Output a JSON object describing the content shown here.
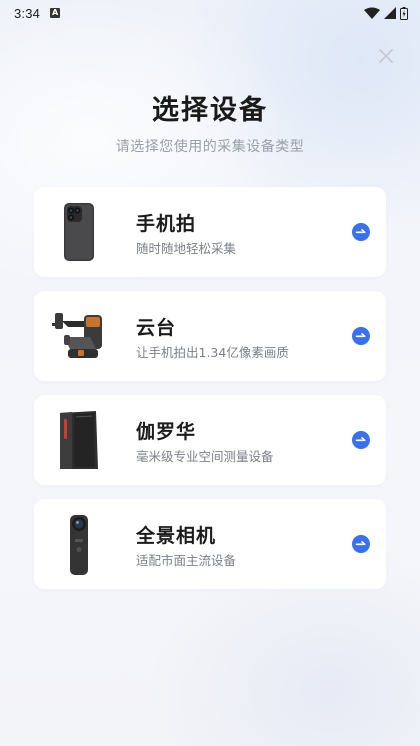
{
  "status_bar": {
    "time": "3:34",
    "badge": "A"
  },
  "header": {
    "title": "选择设备",
    "subtitle": "请选择您使用的采集设备类型"
  },
  "devices": [
    {
      "name": "手机拍",
      "description": "随时随地轻松采集",
      "icon": "smartphone-icon"
    },
    {
      "name": "云台",
      "description": "让手机拍出1.34亿像素画质",
      "icon": "gimbal-icon"
    },
    {
      "name": "伽罗华",
      "description": "毫米级专业空间测量设备",
      "icon": "galois-device-icon"
    },
    {
      "name": "全景相机",
      "description": "适配市面主流设备",
      "icon": "panoramic-camera-icon"
    }
  ],
  "colors": {
    "accent": "#3a6ff2",
    "title": "#1a1a1a",
    "subtitle": "#9aa0a8",
    "card": "#ffffff"
  }
}
